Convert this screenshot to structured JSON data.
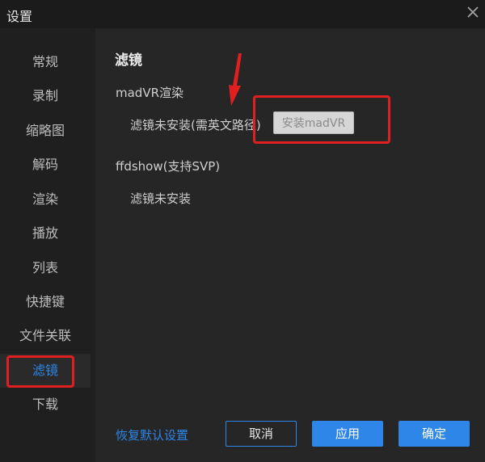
{
  "window": {
    "title": "设置",
    "close_icon": "close-icon"
  },
  "sidebar": {
    "items": [
      {
        "label": "常规"
      },
      {
        "label": "录制"
      },
      {
        "label": "缩略图"
      },
      {
        "label": "解码"
      },
      {
        "label": "渲染"
      },
      {
        "label": "播放"
      },
      {
        "label": "列表"
      },
      {
        "label": "快捷键"
      },
      {
        "label": "文件关联"
      },
      {
        "label": "滤镜",
        "active": true
      },
      {
        "label": "下载"
      }
    ]
  },
  "main": {
    "section_title": "滤镜",
    "madvr": {
      "label": "madVR渲染",
      "status": "滤镜未安装(需英文路径)",
      "install_button": "安装madVR"
    },
    "ffdshow": {
      "label": "ffdshow(支持SVP)",
      "status": "滤镜未安装"
    }
  },
  "footer": {
    "restore_link": "恢复默认设置",
    "cancel": "取消",
    "apply": "应用",
    "ok": "确定"
  },
  "colors": {
    "accent": "#2e86e8",
    "highlight_red": "#e02020",
    "background": "#242424"
  }
}
